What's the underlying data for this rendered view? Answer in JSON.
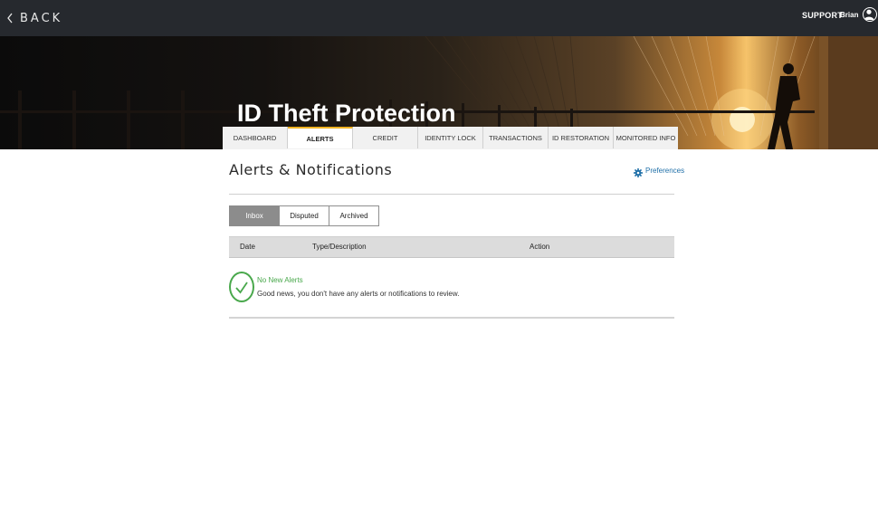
{
  "topbar": {
    "back_label": "BACK",
    "support_label": "SUPPORT",
    "user_name": "Brian"
  },
  "hero": {
    "title": "ID Theft Protection"
  },
  "nav": {
    "tabs": [
      {
        "label": "Dashboard"
      },
      {
        "label": "Alerts"
      },
      {
        "label": "Credit"
      },
      {
        "label": "Identity Lock"
      },
      {
        "label": "Transactions"
      },
      {
        "label": "ID Restoration"
      },
      {
        "label": "Monitored Info"
      }
    ],
    "active_index": 1
  },
  "page": {
    "title": "Alerts & Notifications",
    "preferences_label": "Preferences"
  },
  "subtabs": [
    {
      "label": "Inbox"
    },
    {
      "label": "Disputed"
    },
    {
      "label": "Archived"
    }
  ],
  "table": {
    "columns": [
      "Date",
      "Type/Description",
      "Action"
    ]
  },
  "empty_state": {
    "title": "No New Alerts",
    "description": "Good news, you don't have any alerts or notifications to review."
  },
  "colors": {
    "topbar": "#26292e",
    "accent": "#f0b323",
    "link": "#1f6fa8",
    "success": "#49a84c"
  }
}
